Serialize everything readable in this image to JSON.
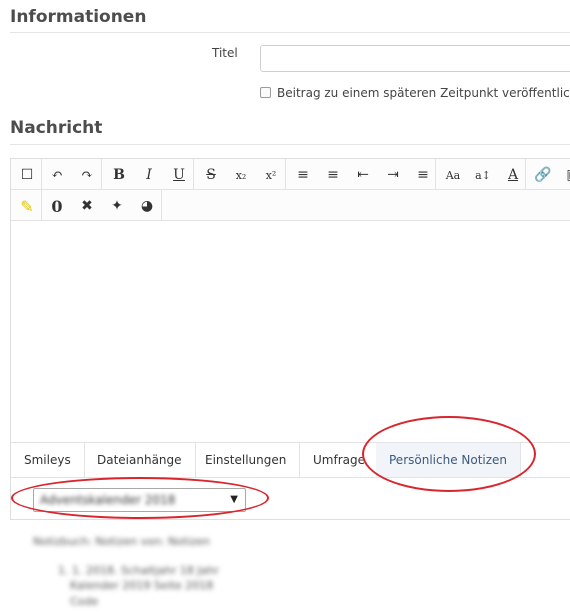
{
  "sections": {
    "info": "Informationen",
    "message": "Nachricht"
  },
  "form": {
    "title_label": "Titel",
    "title_value": "",
    "schedule_label": "Beitrag zu einem späteren Zeitpunkt veröffentlich"
  },
  "toolbar_row1": [
    {
      "name": "remove-format-icon",
      "glyph": "☐"
    },
    {
      "name": "undo-icon",
      "glyph": "↶"
    },
    {
      "name": "redo-icon",
      "glyph": "↷"
    },
    {
      "name": "bold-icon",
      "glyph": "B"
    },
    {
      "name": "italic-icon",
      "glyph": "I"
    },
    {
      "name": "underline-icon",
      "glyph": "U"
    },
    {
      "name": "strikethrough-icon",
      "glyph": "S"
    },
    {
      "name": "subscript-icon",
      "glyph": "x₂"
    },
    {
      "name": "superscript-icon",
      "glyph": "x²"
    },
    {
      "name": "ordered-list-icon",
      "glyph": "≡"
    },
    {
      "name": "unordered-list-icon",
      "glyph": "≡"
    },
    {
      "name": "outdent-icon",
      "glyph": "⇤"
    },
    {
      "name": "indent-icon",
      "glyph": "⇥"
    },
    {
      "name": "align-icon",
      "glyph": "≡"
    },
    {
      "name": "font-size-icon",
      "glyph": "Aa"
    },
    {
      "name": "text-size-icon",
      "glyph": "a↕"
    },
    {
      "name": "font-color-icon",
      "glyph": "A"
    },
    {
      "name": "link-icon",
      "glyph": "🔗"
    },
    {
      "name": "image-icon",
      "glyph": "▣"
    }
  ],
  "toolbar_row2": [
    {
      "name": "highlight-icon",
      "glyph": "✎"
    },
    {
      "name": "spoiler-icon",
      "glyph": "0"
    },
    {
      "name": "close-circle-icon",
      "glyph": "✖"
    },
    {
      "name": "emblem-icon",
      "glyph": "✦"
    },
    {
      "name": "globe-icon",
      "glyph": "◕"
    }
  ],
  "tabs": [
    {
      "label": "Smileys",
      "active": false
    },
    {
      "label": "Dateianhänge",
      "active": false
    },
    {
      "label": "Einstellungen",
      "active": false
    },
    {
      "label": "Umfrage",
      "active": false
    },
    {
      "label": "Persönliche Notizen",
      "active": true
    }
  ],
  "notes": {
    "selected": "Adventskalender 2018",
    "heading": "Notizbuch: Notizen von: Notizen",
    "line1": "1. 1. 2018. Schaltjahr 18 Jahr",
    "line2": "Kalender 2019 Seite 2018",
    "line3": "Code"
  },
  "colors": {
    "accent": "#3b5a7e",
    "annotation": "#d9262e"
  }
}
